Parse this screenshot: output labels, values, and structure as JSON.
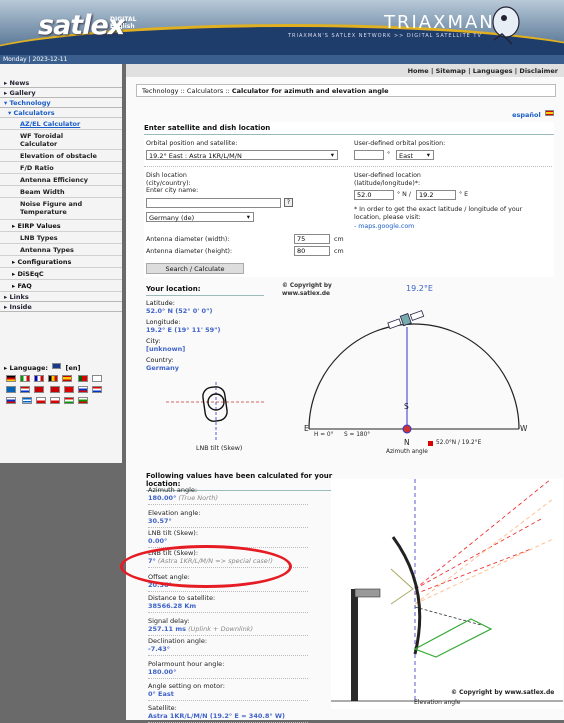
{
  "header": {
    "logo": "satlex",
    "logo_sub1": "DIGITAL",
    "logo_sub2": "English",
    "brand": "TRIAXMAN",
    "brand_tagline": "TRIAXMAN'S SATLEX NETWORK >> DIGITAL SATELLITE TV"
  },
  "datebar": {
    "text": "Monday | 2023-12-11"
  },
  "topnav": [
    "Home",
    "Sitemap",
    "Languages",
    "Disclaimer"
  ],
  "breadcrumb": {
    "path": "Technology :: Calculators :: ",
    "current": "Calculator for azimuth and elevation angle"
  },
  "language_link": "español",
  "sidebar": {
    "news": "▸ News",
    "gallery": "▸ Gallery",
    "technology": "▾ Technology",
    "calculators": "▾ Calculators",
    "items": [
      "AZ/EL Calculator",
      "WF Toroidal Calculator",
      "Elevation of obstacle",
      "F/D Ratio",
      "Antenna Efficiency",
      "Beam Width",
      "Noise Figure and Temperature"
    ],
    "eirp": "▸ EIRP Values",
    "lnb_types": "LNB Types",
    "antenna_types": "Antenna Types",
    "configurations": "▸ Configurations",
    "diseqc": "▸ DiSEqC",
    "faq": "▸ FAQ",
    "links": "▸ Links",
    "inside": "▸ Inside",
    "language_label": "▸ Language:",
    "language_value": "[en]"
  },
  "form": {
    "title": "Enter satellite and dish location",
    "orbital_label": "Orbital position and satellite:",
    "orbital_value": "19.2° East : Astra 1KR/L/M/N",
    "user_orbital_label": "User-defined orbital position:",
    "user_orbital_value": "",
    "user_orbital_dir": "East",
    "dish_location_label1": "Dish location",
    "dish_location_label2": "(city/country):",
    "city_label": "Enter city name:",
    "city_value": "",
    "country_value": "Germany (de)",
    "user_loc_label1": "User-defined location",
    "user_loc_label2": "(latitude/longitude)*:",
    "lat_value": "52.0",
    "lat_unit": "° N /",
    "lon_value": "19.2",
    "lon_unit": "° E",
    "note": "* In order to get the exact latitude / longitude of your location, please visit:",
    "note_link": "- maps.google.com",
    "width_label": "Antenna diameter (width):",
    "width_value": "75",
    "height_label": "Antenna diameter (height):",
    "height_value": "80",
    "unit_cm": "cm",
    "search_button": "Search / Calculate"
  },
  "location": {
    "title": "Your location:",
    "lat_label": "Latitude:",
    "lat_value": "52.0° N (52° 0' 0\")",
    "lon_label": "Longitude:",
    "lon_value": "19.2° E (19° 11' 59\")",
    "city_label": "City:",
    "city_value": "[unknown]",
    "country_label": "Country:",
    "country_value": "Germany",
    "lnb_caption": "LNB tilt (Skew)",
    "copyright": "© Copyright by www.satlex.de"
  },
  "azimuth_diagram": {
    "sat_label": "19.2°E",
    "h_label": "H = 0°",
    "s_label": "S = 180°",
    "w": "W",
    "e": "E",
    "n": "N",
    "s": "S",
    "legend": "52.0°N / 19.2°E",
    "caption": "Azimuth angle"
  },
  "results": {
    "title": "Following values have been calculated for your location:",
    "items": [
      {
        "label": "Azimuth angle:",
        "value": "180.00°",
        "note": "(True North)"
      },
      {
        "label": "Elevation angle:",
        "value": "30.57°",
        "note": ""
      },
      {
        "label": "LNB tilt (Skew):",
        "value": "0.00°",
        "note": ""
      },
      {
        "label": "LNB tilt (Skew):",
        "value": "7°",
        "note": "(Astra 1KR/L/M/N => special case!)"
      },
      {
        "label": "Offset angle:",
        "value": "20.36°",
        "note": ""
      },
      {
        "label": "Distance to satellite:",
        "value": "38566.28 Km",
        "note": ""
      },
      {
        "label": "Signal delay:",
        "value": "257.11 ms",
        "note": "(Uplink + Downlink)"
      },
      {
        "label": "Declination angle:",
        "value": "-7.43°",
        "note": ""
      },
      {
        "label": "Polarmount hour angle:",
        "value": "180.00°",
        "note": ""
      },
      {
        "label": "Angle setting on motor:",
        "value": "0° East",
        "note": ""
      },
      {
        "label": "Satellite:",
        "value": "Astra 1KR/L/M/N (19.2° E = 340.8° W)",
        "note": ""
      }
    ],
    "elev_caption": "Elevation angle",
    "copyright": "© Copyright by www.satlex.de"
  }
}
